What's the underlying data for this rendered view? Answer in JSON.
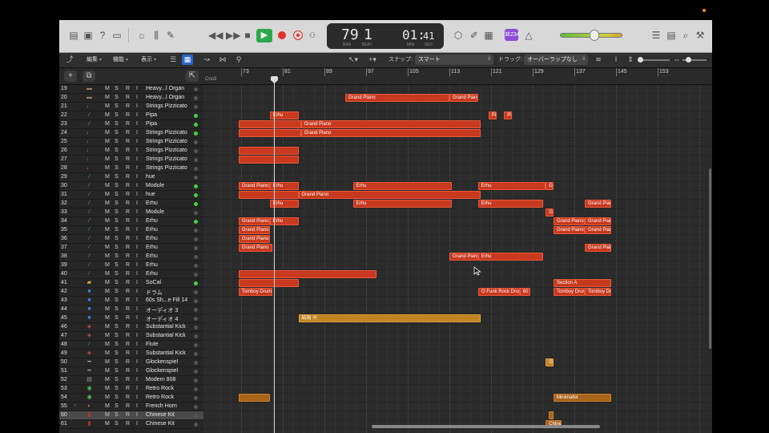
{
  "lcd": {
    "bar": "79",
    "beat": "1",
    "bar_label": "BAR",
    "beat_label": "BEAT",
    "time_min": "01:",
    "time_sec": "41",
    "time_min_label": "MIN",
    "time_sec_label": "SEC"
  },
  "toolbar": {
    "badge": "⌘234"
  },
  "ctrlbar": {
    "edit": "編集",
    "function": "機能",
    "view": "表示",
    "snap_label": "スナップ:",
    "snap_value": "スマート",
    "drag_label": "ドラッグ:",
    "drag_value": "オーバーラップなし"
  },
  "ruler": {
    "marker": "Cno3",
    "bars": [
      "73",
      "81",
      "89",
      "97",
      "105",
      "113",
      "121",
      "129",
      "137",
      "145",
      "153"
    ]
  },
  "tracks": [
    {
      "num": "19",
      "name": "Heavy...l Organ",
      "dot": false,
      "icon": "organ"
    },
    {
      "num": "20",
      "name": "Heavy...l Organ",
      "dot": false,
      "icon": "organ"
    },
    {
      "num": "21",
      "name": "Strings Pizzicato",
      "dot": false,
      "icon": "strings"
    },
    {
      "num": "22",
      "name": "Pipa",
      "dot": true,
      "icon": "guitar"
    },
    {
      "num": "23",
      "name": "Pipa",
      "dot": true,
      "icon": "guitar"
    },
    {
      "num": "24",
      "name": "Strings Pizzicato",
      "dot": true,
      "icon": "strings"
    },
    {
      "num": "25",
      "name": "Strings Pizzicato",
      "dot": false,
      "icon": "strings"
    },
    {
      "num": "26",
      "name": "Strings Pizzicato",
      "dot": false,
      "icon": "strings"
    },
    {
      "num": "27",
      "name": "Strings Pizzicato",
      "dot": false,
      "icon": "strings"
    },
    {
      "num": "28",
      "name": "Strings Pizzicato",
      "dot": false,
      "icon": "strings"
    },
    {
      "num": "29",
      "name": "hue",
      "dot": false,
      "icon": "synth"
    },
    {
      "num": "30",
      "name": "Module",
      "dot": true,
      "icon": "synth"
    },
    {
      "num": "31",
      "name": "hue",
      "dot": true,
      "icon": "synth"
    },
    {
      "num": "32",
      "name": "Erhu",
      "dot": true,
      "icon": "erhu"
    },
    {
      "num": "33",
      "name": "Module",
      "dot": false,
      "icon": "synth"
    },
    {
      "num": "34",
      "name": "Erhu",
      "dot": true,
      "icon": "erhu"
    },
    {
      "num": "35",
      "name": "Erhu",
      "dot": false,
      "icon": "erhu"
    },
    {
      "num": "36",
      "name": "Erhu",
      "dot": false,
      "icon": "erhu"
    },
    {
      "num": "37",
      "name": "Erhu",
      "dot": false,
      "icon": "erhu"
    },
    {
      "num": "38",
      "name": "Erhu",
      "dot": false,
      "icon": "erhu"
    },
    {
      "num": "39",
      "name": "Erhu",
      "dot": false,
      "icon": "erhu"
    },
    {
      "num": "40",
      "name": "Erhu",
      "dot": false,
      "icon": "erhu"
    },
    {
      "num": "41",
      "name": "SoCal",
      "dot": true,
      "icon": "drums"
    },
    {
      "num": "42",
      "name": "ドラム",
      "dot": false,
      "icon": "audio"
    },
    {
      "num": "43",
      "name": "60s Sh...e Fill 14",
      "dot": false,
      "icon": "audio"
    },
    {
      "num": "44",
      "name": "オーディオ 3",
      "dot": false,
      "icon": "audio"
    },
    {
      "num": "45",
      "name": "オーディオ 4",
      "dot": false,
      "icon": "audio"
    },
    {
      "num": "46",
      "name": "Substantial Kick",
      "dot": false,
      "icon": "kick"
    },
    {
      "num": "47",
      "name": "Substantial Kick",
      "dot": false,
      "icon": "kick"
    },
    {
      "num": "48",
      "name": "Flute",
      "dot": false,
      "icon": "flute"
    },
    {
      "num": "49",
      "name": "Substantial Kick",
      "dot": false,
      "icon": "kick"
    },
    {
      "num": "50",
      "name": "Glockenspiel",
      "dot": false,
      "icon": "glock"
    },
    {
      "num": "51",
      "name": "Glockenspiel",
      "dot": false,
      "icon": "glock"
    },
    {
      "num": "52",
      "name": "Modern 808",
      "dot": false,
      "icon": "machine"
    },
    {
      "num": "53",
      "name": "Retro Rock",
      "dot": false,
      "icon": "drumkit"
    },
    {
      "num": "54",
      "name": "Retro Rock",
      "dot": false,
      "icon": "drumkit"
    },
    {
      "num": "55",
      "name": "French Horn",
      "dot": false,
      "icon": "horn"
    },
    {
      "num": "60",
      "name": "Chinese Kit",
      "dot": false,
      "icon": "drum-red"
    },
    {
      "num": "61",
      "name": "Chinese Kit",
      "dot": false,
      "icon": "drum-red"
    }
  ],
  "regions": [
    {
      "row": 1,
      "bar": 93,
      "end": 113,
      "label": "Grand Piano",
      "kind": "midi"
    },
    {
      "row": 1,
      "bar": 113,
      "end": 118.5,
      "label": "Grand Piano",
      "kind": "midi"
    },
    {
      "row": 3,
      "bar": 78.5,
      "end": 84,
      "label": "Erhu",
      "kind": "midi"
    },
    {
      "row": 3,
      "bar": 120.5,
      "end": 122,
      "label": "Pip",
      "kind": "midi"
    },
    {
      "row": 3,
      "bar": 123.5,
      "end": 125,
      "label": "Pip",
      "kind": "midi"
    },
    {
      "row": 4,
      "bar": 72.5,
      "end": 84.5,
      "label": "",
      "kind": "midi"
    },
    {
      "row": 4,
      "bar": 84.5,
      "end": 119,
      "label": "Grand Piano",
      "kind": "midi"
    },
    {
      "row": 5,
      "bar": 72.5,
      "end": 84.5,
      "label": "",
      "kind": "midi"
    },
    {
      "row": 5,
      "bar": 84.5,
      "end": 119,
      "label": "Grand Piano",
      "kind": "midi"
    },
    {
      "row": 7,
      "bar": 72.5,
      "end": 84,
      "label": "",
      "kind": "midi"
    },
    {
      "row": 8,
      "bar": 72.5,
      "end": 84,
      "label": "",
      "kind": "midi"
    },
    {
      "row": 11,
      "bar": 72.5,
      "end": 78.5,
      "label": "Grand Piano",
      "kind": "midi"
    },
    {
      "row": 11,
      "bar": 78.5,
      "end": 84,
      "label": "Erhu",
      "kind": "midi"
    },
    {
      "row": 11,
      "bar": 94.5,
      "end": 113.5,
      "label": "Erhu",
      "kind": "midi"
    },
    {
      "row": 11,
      "bar": 118.5,
      "end": 131.5,
      "label": "Erhu",
      "kind": "midi"
    },
    {
      "row": 11,
      "bar": 131.5,
      "end": 133,
      "label": "Gra",
      "kind": "midi"
    },
    {
      "row": 12,
      "bar": 72.5,
      "end": 84,
      "label": "",
      "kind": "midi"
    },
    {
      "row": 12,
      "bar": 84,
      "end": 119,
      "label": "Grand Piano",
      "kind": "midi"
    },
    {
      "row": 13,
      "bar": 78.5,
      "end": 84,
      "label": "Erhu",
      "kind": "midi"
    },
    {
      "row": 13,
      "bar": 94.5,
      "end": 113.5,
      "label": "Erhu",
      "kind": "midi"
    },
    {
      "row": 13,
      "bar": 118.5,
      "end": 131,
      "label": "Erhu",
      "kind": "midi"
    },
    {
      "row": 13,
      "bar": 139,
      "end": 144,
      "label": "Grand Piano (+2)",
      "kind": "midi"
    },
    {
      "row": 14,
      "bar": 131.5,
      "end": 133,
      "label": "Gra",
      "kind": "midi"
    },
    {
      "row": 15,
      "bar": 72.5,
      "end": 78.5,
      "label": "Grand Piano",
      "kind": "midi"
    },
    {
      "row": 15,
      "bar": 78.5,
      "end": 84,
      "label": "Erhu",
      "kind": "midi"
    },
    {
      "row": 15,
      "bar": 133,
      "end": 139,
      "label": "Grand Piano (+2)",
      "kind": "midi"
    },
    {
      "row": 15,
      "bar": 139,
      "end": 144,
      "label": "Grand Piano (+2)",
      "kind": "midi"
    },
    {
      "row": 16,
      "bar": 72.5,
      "end": 78.5,
      "label": "Grand Piano",
      "kind": "midi"
    },
    {
      "row": 16,
      "bar": 133,
      "end": 139,
      "label": "Grand Piano (+2)",
      "kind": "midi"
    },
    {
      "row": 16,
      "bar": 139,
      "end": 144,
      "label": "Grand Piano (+2)",
      "kind": "midi"
    },
    {
      "row": 17,
      "bar": 72.5,
      "end": 78.5,
      "label": "Grand Piano (-12)",
      "kind": "midi"
    },
    {
      "row": 18,
      "bar": 72.5,
      "end": 79,
      "label": "Grand Piano",
      "kind": "midi"
    },
    {
      "row": 18,
      "bar": 139,
      "end": 144,
      "label": "Grand Piano",
      "kind": "midi"
    },
    {
      "row": 19,
      "bar": 113,
      "end": 118.5,
      "label": "Grand Piano",
      "kind": "midi"
    },
    {
      "row": 19,
      "bar": 118.5,
      "end": 131,
      "label": "Erhu",
      "kind": "midi"
    },
    {
      "row": 21,
      "bar": 72.5,
      "end": 99,
      "label": "",
      "kind": "midi"
    },
    {
      "row": 22,
      "bar": 72.5,
      "end": 84,
      "label": "",
      "kind": "midi"
    },
    {
      "row": 22,
      "bar": 133,
      "end": 144,
      "label": "Section A",
      "kind": "midi"
    },
    {
      "row": 23,
      "bar": 72.5,
      "end": 79,
      "label": "Tomboy Drumset",
      "kind": "midi"
    },
    {
      "row": 23,
      "bar": 118.5,
      "end": 126.5,
      "label": "⭘ Funk Rock Drums 06.2 ∞",
      "kind": "midi"
    },
    {
      "row": 23,
      "bar": 126.5,
      "end": 128.5,
      "label": "60",
      "kind": "midi"
    },
    {
      "row": 23,
      "bar": 133,
      "end": 139,
      "label": "Tomboy Drumset",
      "kind": "midi"
    },
    {
      "row": 23,
      "bar": 139,
      "end": 144,
      "label": "Tomboy Drum",
      "kind": "midi"
    },
    {
      "row": 26,
      "bar": 84,
      "end": 119,
      "label": "結局 ⦿",
      "kind": "audio"
    },
    {
      "row": 31,
      "bar": 131.5,
      "end": 133,
      "label": "Gra",
      "kind": "audio"
    },
    {
      "row": 35,
      "bar": 72.5,
      "end": 78.5,
      "label": "",
      "kind": "audio2"
    },
    {
      "row": 35,
      "bar": 133,
      "end": 144,
      "label": "Minimalist",
      "kind": "audio2"
    },
    {
      "row": 37,
      "bar": 132,
      "end": 133,
      "label": "",
      "kind": "audio2"
    },
    {
      "row": 38,
      "bar": 131.5,
      "end": 134.5,
      "label": "Chinese",
      "kind": "audio2"
    }
  ]
}
